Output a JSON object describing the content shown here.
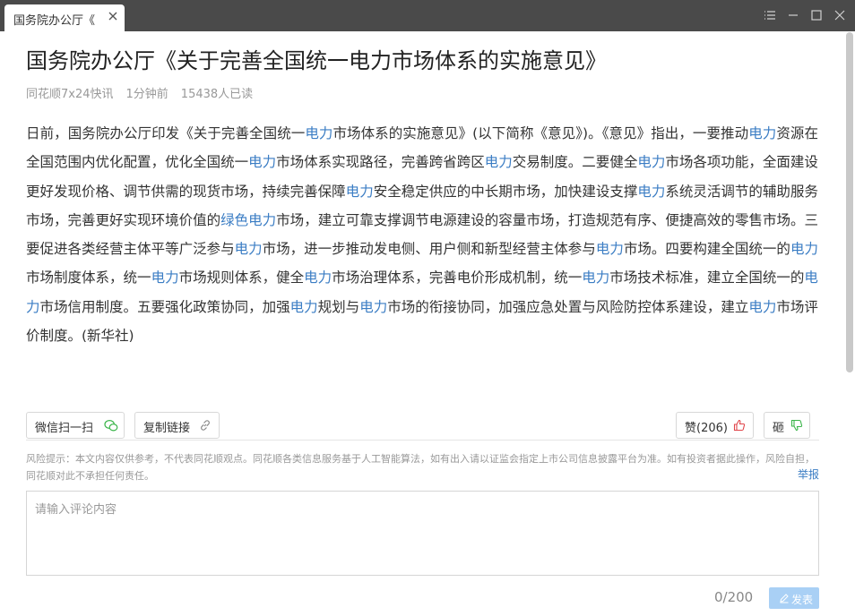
{
  "tab": {
    "title": "国务院办公厅《"
  },
  "article": {
    "title": "国务院办公厅《关于完善全国统一电力市场体系的实施意见》",
    "source": "同花顺7x24快讯",
    "time": "1分钟前",
    "views": "15438人已读",
    "segments": [
      {
        "text": "日前，国务院办公厅印发《关于完善全国统一",
        "hl": false
      },
      {
        "text": "电力",
        "hl": true
      },
      {
        "text": "市场体系的实施意见》(以下简称《意见》)。《意见》指出，一要推动",
        "hl": false
      },
      {
        "text": "电力",
        "hl": true
      },
      {
        "text": "资源在全国范围内优化配置，优化全国统一",
        "hl": false
      },
      {
        "text": "电力",
        "hl": true
      },
      {
        "text": "市场体系实现路径，完善跨省跨区",
        "hl": false
      },
      {
        "text": "电力",
        "hl": true
      },
      {
        "text": "交易制度。二要健全",
        "hl": false
      },
      {
        "text": "电力",
        "hl": true
      },
      {
        "text": "市场各项功能，全面建设更好发现价格、调节供需的现货市场，持续完善保障",
        "hl": false
      },
      {
        "text": "电力",
        "hl": true
      },
      {
        "text": "安全稳定供应的中长期市场，加快建设支撑",
        "hl": false
      },
      {
        "text": "电力",
        "hl": true
      },
      {
        "text": "系统灵活调节的辅助服务市场，完善更好实现环境价值的",
        "hl": false
      },
      {
        "text": "绿色电力",
        "hl": true
      },
      {
        "text": "市场，建立可靠支撑调节电源建设的容量市场，打造规范有序、便捷高效的零售市场。三要促进各类经营主体平等广泛参与",
        "hl": false
      },
      {
        "text": "电力",
        "hl": true
      },
      {
        "text": "市场，进一步推动发电侧、用户侧和新型经营主体参与",
        "hl": false
      },
      {
        "text": "电力",
        "hl": true
      },
      {
        "text": "市场。四要构建全国统一的",
        "hl": false
      },
      {
        "text": "电力",
        "hl": true
      },
      {
        "text": "市场制度体系，统一",
        "hl": false
      },
      {
        "text": "电力",
        "hl": true
      },
      {
        "text": "市场规则体系，健全",
        "hl": false
      },
      {
        "text": "电力",
        "hl": true
      },
      {
        "text": "市场治理体系，完善电价形成机制，统一",
        "hl": false
      },
      {
        "text": "电力",
        "hl": true
      },
      {
        "text": "市场技术标准，建立全国统一的",
        "hl": false
      },
      {
        "text": "电力",
        "hl": true
      },
      {
        "text": "市场信用制度。五要强化政策协同，加强",
        "hl": false
      },
      {
        "text": "电力",
        "hl": true
      },
      {
        "text": "规划与",
        "hl": false
      },
      {
        "text": "电力",
        "hl": true
      },
      {
        "text": "市场的衔接协同，加强应急处置与风险防控体系建设，建立",
        "hl": false
      },
      {
        "text": "电力",
        "hl": true
      },
      {
        "text": "市场评价制度。(新华社)",
        "hl": false
      }
    ]
  },
  "actions": {
    "wechat_scan": "微信扫一扫",
    "copy_link": "复制链接",
    "like": "赞(206)",
    "dislike": "砸"
  },
  "risk_notice": "风险提示：本文内容仅供参考，不代表同花顺观点。同花顺各类信息服务基于人工智能算法，如有出入请以证监会指定上市公司信息披露平台为准。如有投资者据此操作，风险自担，同花顺对此不承担任何责任。",
  "report": "举报",
  "comment": {
    "placeholder": "请输入评论内容",
    "counter": "0/200",
    "send": "发表"
  },
  "colors": {
    "titlebar": "#4a4a4a",
    "highlight": "#3b7dc4",
    "like_red": "#e0454a",
    "wechat_green": "#3bb54a",
    "send_bg": "#a9d0f5"
  },
  "icons": [
    "close-icon",
    "list-icon",
    "minimize-icon",
    "maximize-icon",
    "window-close-icon",
    "wechat-icon",
    "link-icon",
    "thumbs-up-icon",
    "thumbs-down-icon",
    "pencil-icon"
  ]
}
